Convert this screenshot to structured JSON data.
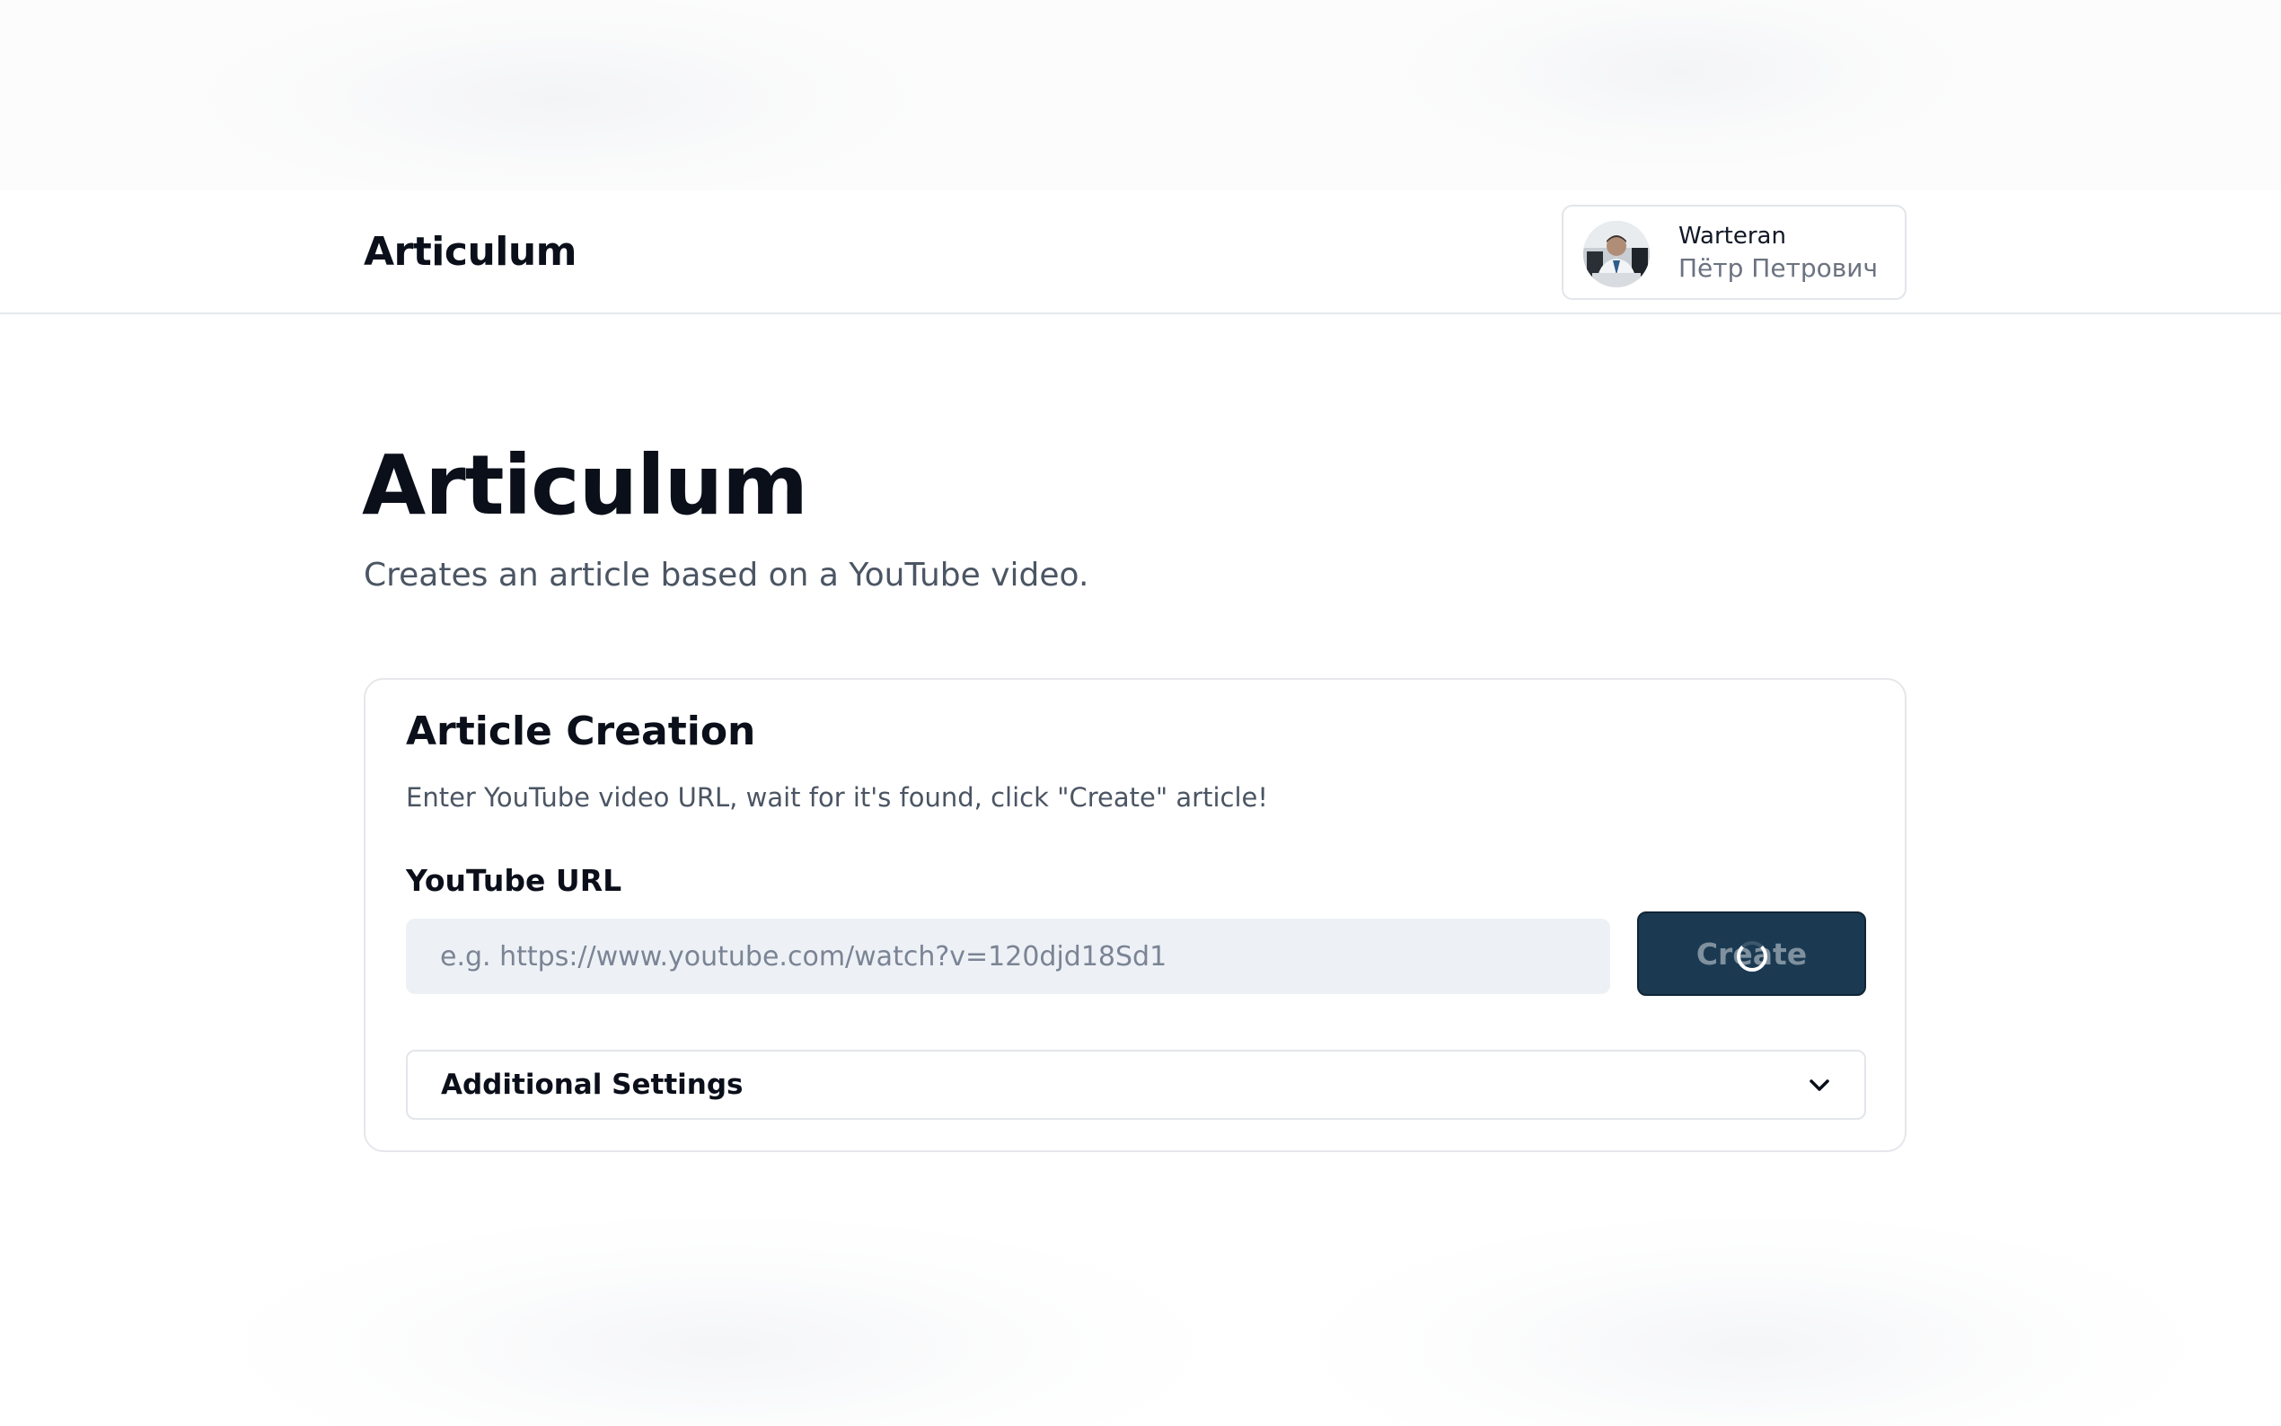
{
  "header": {
    "logo": "Articulum",
    "user": {
      "name": "Warteran",
      "subtitle": "Пётр Петрович",
      "avatar_icon": "user-avatar-photo"
    }
  },
  "hero": {
    "title": "Articulum",
    "subtitle": "Creates an article based on a YouTube video."
  },
  "card": {
    "title": "Article Creation",
    "description": "Enter YouTube video URL, wait for it's found, click \"Create\" article!",
    "url_field": {
      "label": "YouTube URL",
      "value": "",
      "placeholder": "e.g. https://www.youtube.com/watch?v=120djd18Sd1"
    },
    "create_button": {
      "label": "Create",
      "state_icon": "loading-spinner-icon"
    },
    "settings": {
      "label": "Additional Settings",
      "icon": "chevron-down-icon"
    }
  },
  "colors": {
    "button_bg": "#1b3a52",
    "input_bg": "#edf1f6",
    "border": "#e5e7eb"
  }
}
